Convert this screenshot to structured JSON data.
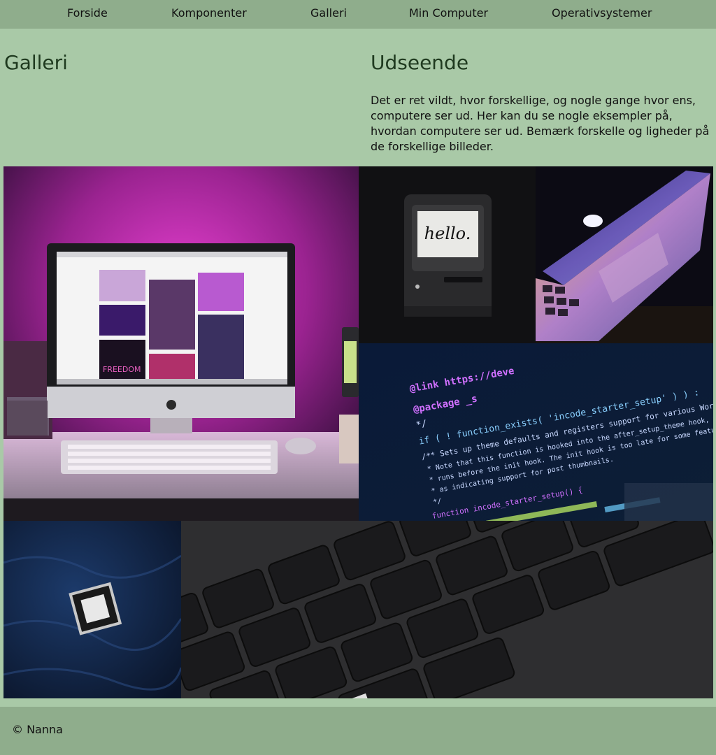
{
  "nav": {
    "items": [
      {
        "label": "Forside"
      },
      {
        "label": "Komponenter"
      },
      {
        "label": "Galleri"
      },
      {
        "label": "Min Computer"
      },
      {
        "label": "Operativsystemer"
      }
    ]
  },
  "header": {
    "left_title": "Galleri",
    "right_title": "Udseende",
    "intro": "Det er ret vildt, hvor forskellige, og nogle gange hvor ens, computere ser ud. Her kan du se nogle eksempler på, hvordan computere ser ud. Bemærk forskelle og ligheder på de forskellige billeder."
  },
  "gallery": {
    "hello_text": "hello.",
    "freedom_text": "FREEDOM",
    "code_lines": [
      "@link https://deve",
      "@package _s",
      "*/",
      "if ( ! function_exists( 'incode_starter_setup' ) ) :",
      "/** Sets up theme defaults and registers support for various WordPress fea",
      " * Note that this function is hooked into the after_setup_theme hook, which",
      " * runs before the init hook. The init hook is too late for some features.",
      " * as indicating support for post thumbnails.",
      " */",
      "function incode_starter_setup() {"
    ]
  },
  "footer": {
    "text": "© Nanna"
  },
  "colors": {
    "nav_bg": "#8fad8c",
    "page_bg": "#a9c9a7",
    "heading": "#1f3a1f"
  }
}
